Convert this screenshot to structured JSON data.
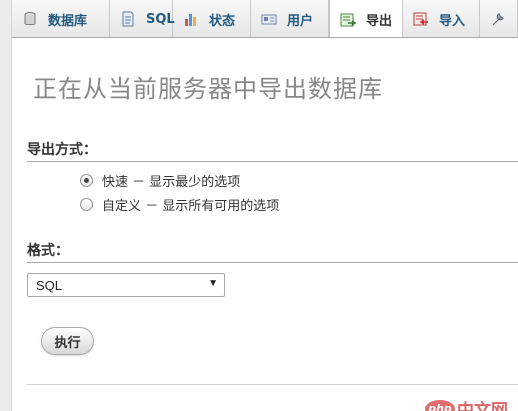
{
  "tabs": {
    "databases": "数据库",
    "sql": "SQL",
    "status": "状态",
    "users": "用户",
    "export": "导出",
    "import": "导入"
  },
  "page": {
    "title": "正在从当前服务器中导出数据库"
  },
  "export_method": {
    "heading": "导出方式：",
    "options": [
      {
        "label": "快速 － 显示最少的选项",
        "checked": true
      },
      {
        "label": "自定义 － 显示所有可用的选项",
        "checked": false
      }
    ]
  },
  "format": {
    "heading": "格式：",
    "selected": "SQL"
  },
  "actions": {
    "go_label": "执行"
  },
  "watermark": {
    "logo": "php",
    "text": "中文网"
  },
  "colors": {
    "tab_link": "#235a81",
    "title_gray": "#888888",
    "watermark_red": "#d93b3b"
  }
}
